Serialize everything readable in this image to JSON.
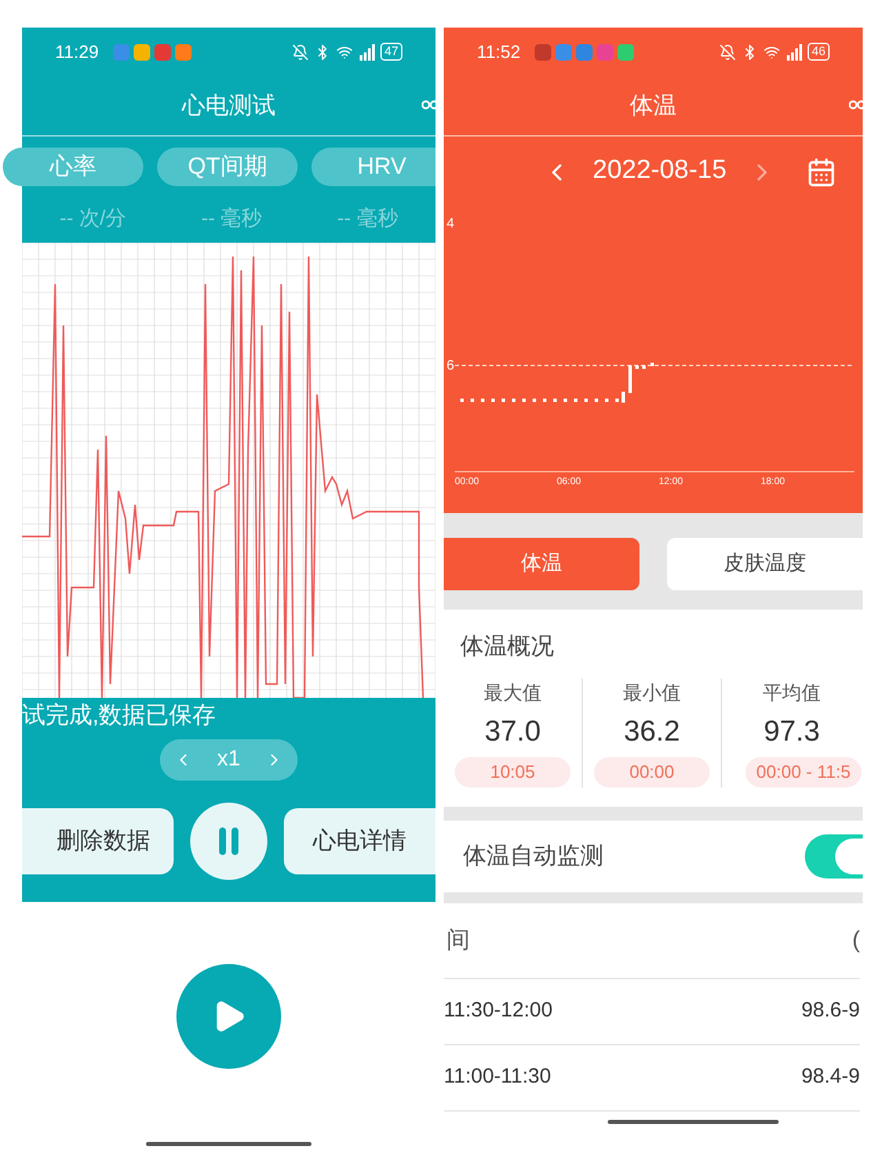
{
  "left": {
    "status_bar": {
      "time": "11:29",
      "battery": "47"
    },
    "title": "心电测试",
    "tabs": [
      {
        "label": "心率",
        "selected": false
      },
      {
        "label": "QT间期",
        "selected": false
      },
      {
        "label": "HRV",
        "selected": false
      }
    ],
    "readings": [
      {
        "value": "--",
        "unit": "次/分"
      },
      {
        "value": "--",
        "unit": "毫秒"
      },
      {
        "value": "--",
        "unit": "毫秒"
      }
    ],
    "status_message": "试完成,数据已保存",
    "speed": "x1",
    "buttons": [
      "删除数据",
      "心电详情"
    ]
  },
  "right": {
    "status_bar": {
      "time": "11:52",
      "battery": "46"
    },
    "title": "体温",
    "date": "2022-08-15",
    "chart": {
      "y_labels": [
        "4",
        "6"
      ],
      "x_labels": [
        "00:00",
        "06:00",
        "12:00",
        "18:00"
      ]
    },
    "tabs": [
      {
        "label": "体温",
        "selected": true
      },
      {
        "label": "皮肤温度",
        "selected": false
      }
    ],
    "summary": {
      "title": "体温概况",
      "stats": [
        {
          "label": "最大值",
          "value": "37.0",
          "time": "10:05"
        },
        {
          "label": "最小值",
          "value": "36.2",
          "time": "00:00"
        },
        {
          "label": "平均值",
          "value": "97.3",
          "time": "00:00 - 11:5"
        }
      ]
    },
    "auto_monitor": {
      "label": "体温自动监测",
      "on": true
    },
    "table": {
      "columns": [
        "间",
        "("
      ],
      "rows": [
        [
          "11:30-12:00",
          "98.6-9"
        ],
        [
          "11:00-11:30",
          "98.4-9"
        ]
      ]
    }
  }
}
